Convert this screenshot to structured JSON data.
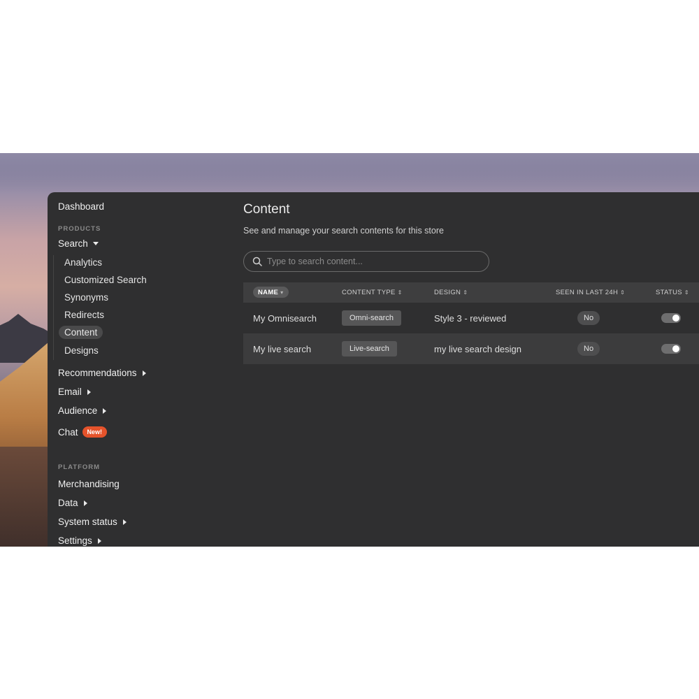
{
  "sidebar": {
    "dashboard": "Dashboard",
    "products_label": "PRODUCTS",
    "search": "Search",
    "search_items": [
      "Analytics",
      "Customized Search",
      "Synonyms",
      "Redirects",
      "Content",
      "Designs"
    ],
    "active_item": "Content",
    "recommendations": "Recommendations",
    "email": "Email",
    "audience": "Audience",
    "chat": "Chat",
    "chat_badge": "New!",
    "platform_label": "PLATFORM",
    "merchandising": "Merchandising",
    "data": "Data",
    "system_status": "System status",
    "settings": "Settings"
  },
  "main": {
    "title": "Content",
    "subtitle": "See and manage your search contents for this store",
    "search_placeholder": "Type to search content..."
  },
  "table": {
    "columns": {
      "name": "NAME",
      "content_type": "CONTENT TYPE",
      "design": "DESIGN",
      "seen": "SEEN IN LAST 24H",
      "status": "STATUS"
    },
    "rows": [
      {
        "name": "My Omnisearch",
        "content_type": "Omni-search",
        "design": "Style 3 - reviewed",
        "seen": "No",
        "status_on": true
      },
      {
        "name": "My live search",
        "content_type": "Live-search",
        "design": "my live search design",
        "seen": "No",
        "status_on": true
      }
    ]
  },
  "colors": {
    "panel": "#2f2f30",
    "accent_badge": "#e5532b"
  }
}
